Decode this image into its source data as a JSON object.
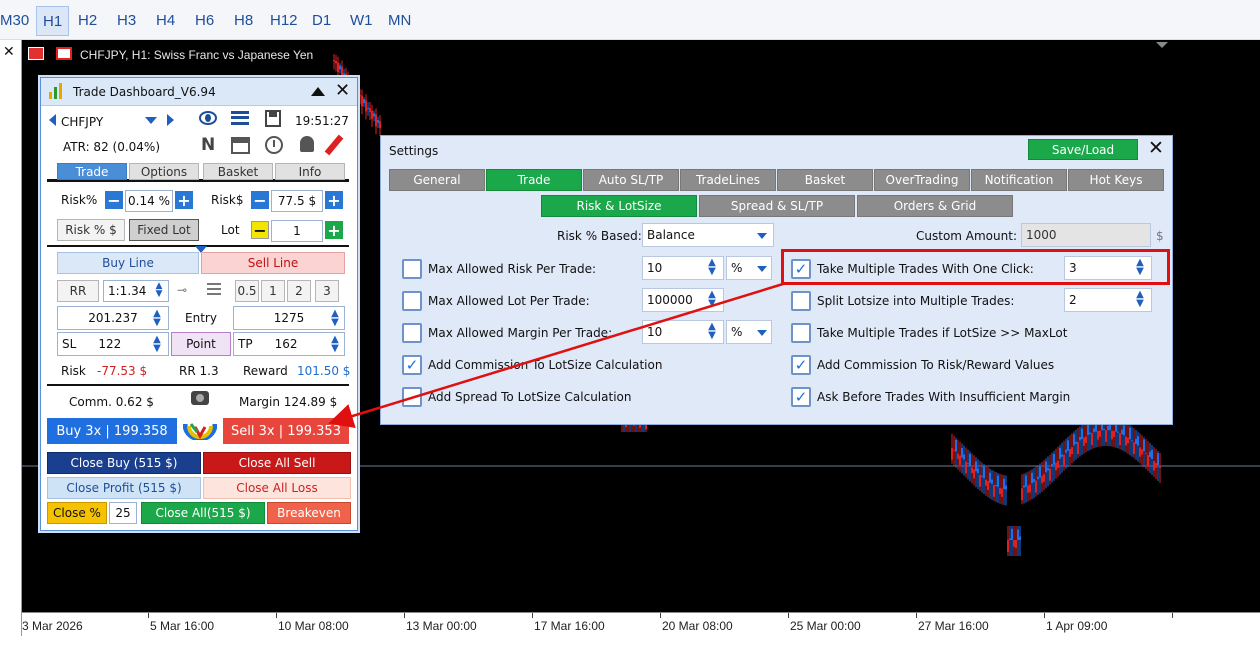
{
  "timeframes": [
    "M30",
    "H1",
    "H2",
    "H3",
    "H4",
    "H6",
    "H8",
    "H12",
    "D1",
    "W1",
    "MN"
  ],
  "active_timeframe": "H1",
  "close_glyph": "✕",
  "chart": {
    "title": "CHFJPY, H1:  Swiss Franc vs Japanese Yen",
    "x_ticks": [
      "3 Mar 2026",
      "5 Mar 16:00",
      "10 Mar 08:00",
      "13 Mar 00:00",
      "17 Mar 16:00",
      "20 Mar 08:00",
      "25 Mar 00:00",
      "27 Mar 16:00",
      "1 Apr 09:00"
    ],
    "bull_color": "#1e6fe8",
    "bear_color": "#e02020"
  },
  "dashboard": {
    "title": "Trade Dashboard_V6.94",
    "symbol": "CHFJPY",
    "time": "19:51:27",
    "atr": "ATR:  82 (0.04%)",
    "n_label": "N",
    "tabs": [
      "Trade",
      "Options",
      "Basket",
      "Info"
    ],
    "risk_pct_label": "Risk%",
    "risk_pct_value": "0.14 %",
    "risk_usd_label": "Risk$",
    "risk_usd_value": "77.5 $",
    "mode_risk": "Risk % $",
    "mode_fixed": "Fixed Lot",
    "lot_label": "Lot",
    "lot_value": "1",
    "buy_line": "Buy Line",
    "sell_line": "Sell Line",
    "rr_label": "RR",
    "rr_value": "1:1.34",
    "qty_buttons": [
      "0.5",
      "1",
      "2",
      "3"
    ],
    "entry_left": "201.237",
    "entry_label": "Entry",
    "entry_right": "1275",
    "sl_label": "SL",
    "sl_value": "122",
    "point_label": "Point",
    "tp_label": "TP",
    "tp_value": "162",
    "risk_label": "Risk",
    "risk_value": "-77.53 $",
    "rr_ratio": "RR 1.3",
    "reward_label": "Reward",
    "reward_value": "101.50 $",
    "comm": "Comm. 0.62 $",
    "margin": "Margin 124.89 $",
    "buy_btn": "Buy 3x  |  199.358",
    "sell_btn": "Sell 3x  |  199.353",
    "close_buy": "Close Buy (515 $)",
    "close_all_sell": "Close All Sell",
    "close_profit": "Close Profit (515 $)",
    "close_all_loss": "Close All Loss",
    "close_pct_label": "Close %",
    "close_pct_value": "25",
    "close_all": "Close All(515 $)",
    "breakeven": "Breakeven"
  },
  "settings": {
    "title": "Settings",
    "save_load": "Save/Load",
    "tabs": [
      "General",
      "Trade",
      "Auto SL/TP",
      "TradeLines",
      "Basket",
      "OverTrading",
      "Notification",
      "Hot Keys"
    ],
    "active_tab": "Trade",
    "subtabs": [
      "Risk & LotSize",
      "Spread & SL/TP",
      "Orders & Grid"
    ],
    "active_subtab": "Risk & LotSize",
    "risk_based_label": "Risk % Based:",
    "risk_based_value": "Balance",
    "custom_amount_label": "Custom Amount:",
    "custom_amount_value": "1000",
    "custom_amount_unit": "$",
    "left_options": [
      {
        "label": "Max Allowed Risk Per Trade:",
        "checked": false,
        "value": "10",
        "unit": "%"
      },
      {
        "label": "Max Allowed Lot Per Trade:",
        "checked": false,
        "value": "100000",
        "unit": ""
      },
      {
        "label": "Max Allowed Margin Per Trade:",
        "checked": false,
        "value": "10",
        "unit": "%"
      },
      {
        "label": "Add Commission To LotSize Calculation",
        "checked": true
      },
      {
        "label": "Add Spread To LotSize Calculation",
        "checked": false
      }
    ],
    "right_options": [
      {
        "label": "Take Multiple Trades With One Click:",
        "checked": true,
        "value": "3"
      },
      {
        "label": "Split Lotsize into Multiple Trades:",
        "checked": false,
        "value": "2"
      },
      {
        "label": "Take Multiple Trades if LotSize >> MaxLot",
        "checked": false
      },
      {
        "label": "Add Commission To Risk/Reward Values",
        "checked": true
      },
      {
        "label": "Ask Before Trades With Insufficient Margin",
        "checked": true
      }
    ],
    "check_glyph": "✓"
  }
}
